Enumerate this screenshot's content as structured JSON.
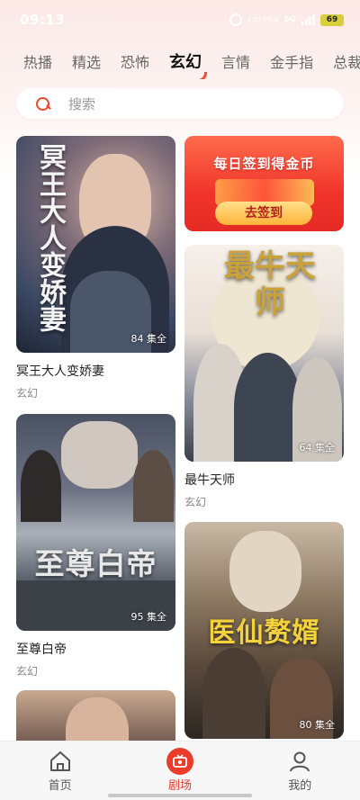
{
  "status_bar": {
    "time": "09:13",
    "net_speed": "2.50\nMB/s",
    "network": "5G",
    "battery": "69"
  },
  "tabs": [
    {
      "label": "热播",
      "active": false
    },
    {
      "label": "精选",
      "active": false
    },
    {
      "label": "恐怖",
      "active": false
    },
    {
      "label": "玄幻",
      "active": true
    },
    {
      "label": "言情",
      "active": false
    },
    {
      "label": "金手指",
      "active": false
    },
    {
      "label": "总裁",
      "active": false
    }
  ],
  "search": {
    "placeholder": "搜索"
  },
  "banner": {
    "title": "每日签到得金币",
    "button_label": "去签到"
  },
  "dramas": [
    {
      "title": "冥王大人变娇妻",
      "genre": "玄幻",
      "episodes": "84 集全",
      "poster_text": "冥王大人变娇妻"
    },
    {
      "title": "最牛天师",
      "genre": "玄幻",
      "episodes": "64 集全",
      "poster_text": "最牛天师"
    },
    {
      "title": "至尊白帝",
      "genre": "玄幻",
      "episodes": "95 集全",
      "poster_text": "至尊白帝"
    },
    {
      "title": "",
      "genre": "",
      "episodes": "80 集全",
      "poster_text": "医仙赘婿"
    }
  ],
  "bottom_nav": [
    {
      "label": "首页",
      "icon": "home-icon",
      "active": false
    },
    {
      "label": "剧场",
      "icon": "theater-icon",
      "active": true
    },
    {
      "label": "我的",
      "icon": "profile-icon",
      "active": false
    }
  ],
  "colors": {
    "accent": "#e8392a",
    "tab_active": "#111111",
    "tab_inactive": "#666666"
  }
}
